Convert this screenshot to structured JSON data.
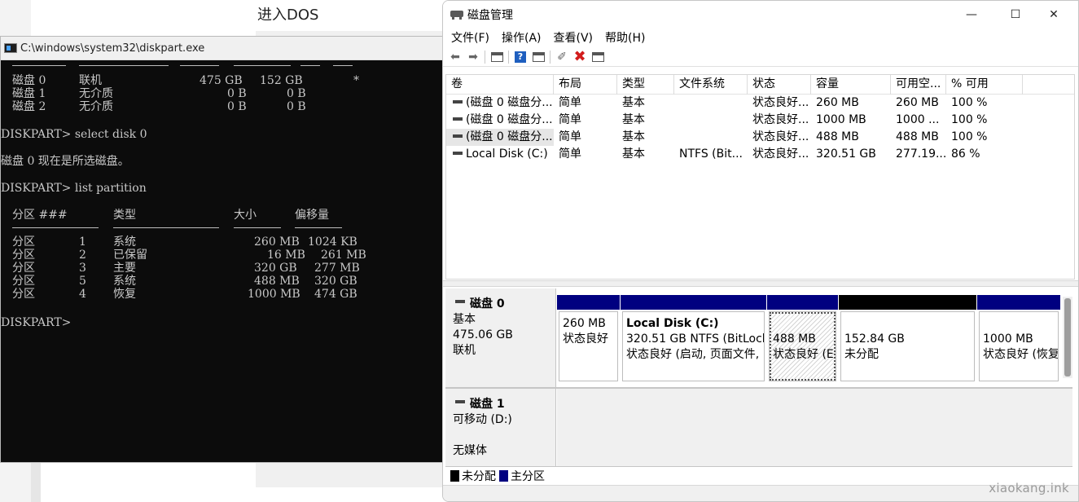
{
  "background": {
    "title": "进入DOS",
    "watermark": "xiaokang.ink"
  },
  "cmd": {
    "title": "C:\\windows\\system32\\diskpart.exe",
    "disk_rows": [
      [
        "磁盘 0",
        "联机",
        "475 GB",
        "152 GB",
        "*"
      ],
      [
        "磁盘 1",
        "无介质",
        "0 B",
        "0 B",
        ""
      ],
      [
        "磁盘 2",
        "无介质",
        "0 B",
        "0 B",
        ""
      ]
    ],
    "lines": {
      "select_cmd": "DISKPART> select disk 0",
      "selected_msg": "磁盘 0 现在是所选磁盘。",
      "list_cmd": "DISKPART> list partition",
      "prompt": "DISKPART>"
    },
    "partition_header": [
      "分区 ###",
      "类型",
      "大小",
      "偏移量"
    ],
    "partitions": [
      [
        "分区",
        "1",
        "系统",
        "260 MB",
        "1024 KB"
      ],
      [
        "分区",
        "2",
        "已保留",
        "16 MB",
        "261 MB"
      ],
      [
        "分区",
        "3",
        "主要",
        "320 GB",
        "277 MB"
      ],
      [
        "分区",
        "5",
        "系统",
        "488 MB",
        "320 GB"
      ],
      [
        "分区",
        "4",
        "恢复",
        "1000 MB",
        "474 GB"
      ]
    ]
  },
  "diskmgmt": {
    "title": "磁盘管理",
    "window_buttons": {
      "minimize": "—",
      "maximize": "☐",
      "close": "✕"
    },
    "menu": [
      "文件(F)",
      "操作(A)",
      "查看(V)",
      "帮助(H)"
    ],
    "columns": [
      "卷",
      "布局",
      "类型",
      "文件系统",
      "状态",
      "容量",
      "可用空...",
      "% 可用"
    ],
    "volumes": [
      [
        "(磁盘 0 磁盘分...",
        "简单",
        "基本",
        "",
        "状态良好...",
        "260 MB",
        "260 MB",
        "100 %"
      ],
      [
        "(磁盘 0 磁盘分...",
        "简单",
        "基本",
        "",
        "状态良好...",
        "1000 MB",
        "1000 ...",
        "100 %"
      ],
      [
        "(磁盘 0 磁盘分...",
        "简单",
        "基本",
        "",
        "状态良好...",
        "488 MB",
        "488 MB",
        "100 %"
      ],
      [
        "Local Disk (C:)",
        "简单",
        "基本",
        "NTFS (Bit...",
        "状态良好...",
        "320.51 GB",
        "277.19...",
        "86 %"
      ]
    ],
    "disks": [
      {
        "name": "磁盘 0",
        "type": "基本",
        "size": "475.06 GB",
        "status": "联机"
      },
      {
        "name": "磁盘 1",
        "type": "可移动 (D:)",
        "size": "",
        "status": "无媒体"
      }
    ],
    "partitions": [
      {
        "name": "",
        "line1": "260 MB",
        "line2": "状态良好"
      },
      {
        "name": "Local Disk  (C:)",
        "line1": "320.51 GB NTFS (BitLock",
        "line2": "状态良好 (启动, 页面文件,"
      },
      {
        "name": "",
        "line1": "488 MB",
        "line2": "状态良好 (E"
      },
      {
        "name": "",
        "line1": "152.84 GB",
        "line2": "未分配"
      },
      {
        "name": "",
        "line1": "1000 MB",
        "line2": "状态良好 (恢复"
      }
    ],
    "legend": [
      "未分配",
      "主分区"
    ],
    "colors": {
      "primary": "#000080",
      "unallocated": "#000000"
    }
  }
}
